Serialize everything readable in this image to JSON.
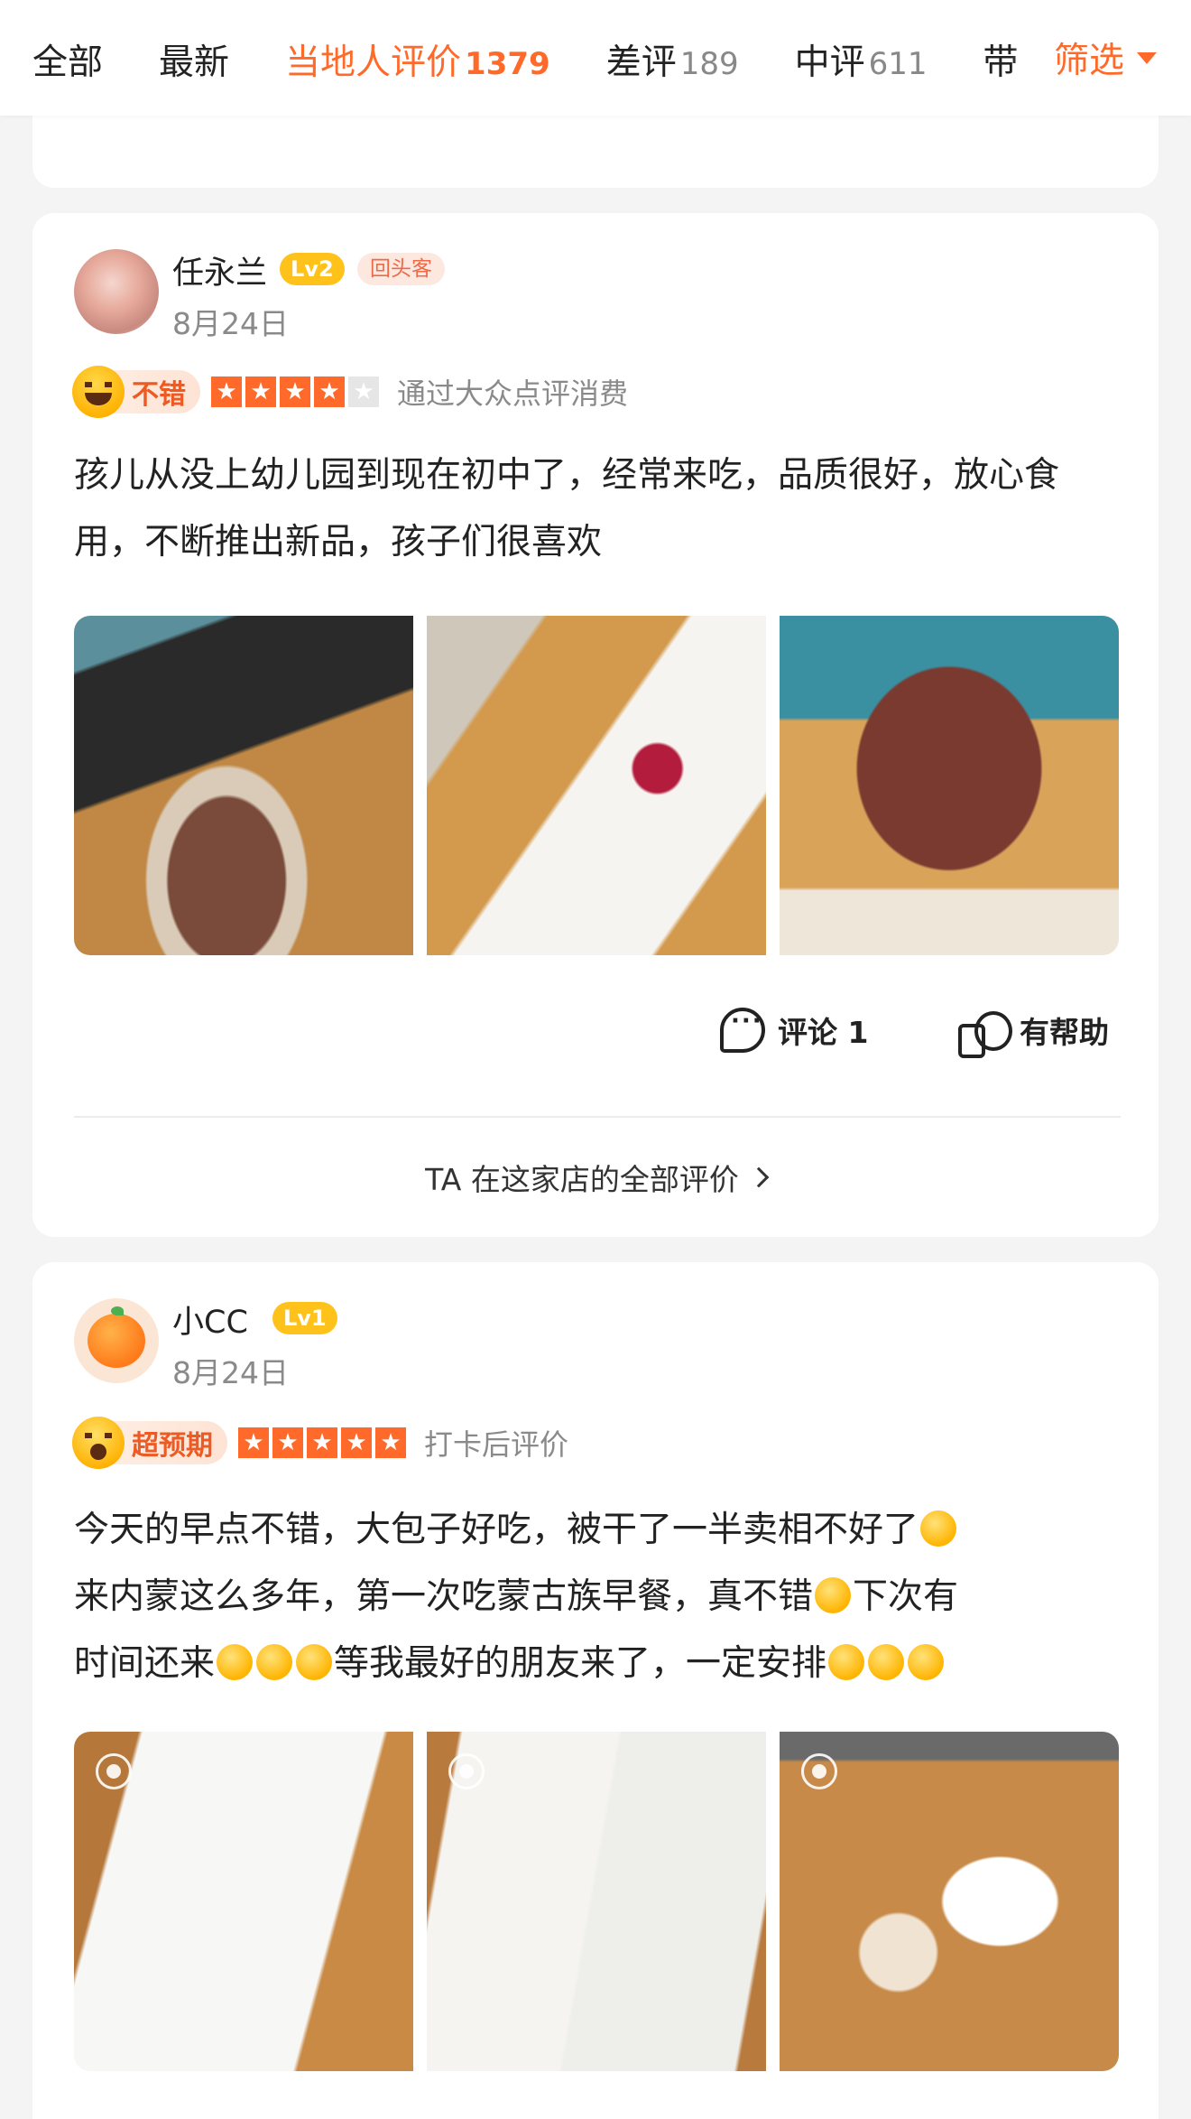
{
  "tabs": [
    {
      "label": "全部",
      "count": ""
    },
    {
      "label": "最新",
      "count": ""
    },
    {
      "label": "当地人评价",
      "count": "1379"
    },
    {
      "label": "差评",
      "count": "189"
    },
    {
      "label": "中评",
      "count": "611"
    },
    {
      "label": "带",
      "count": ""
    }
  ],
  "filter_label": "筛选",
  "reviews": [
    {
      "username": "任永兰",
      "level": "Lv2",
      "badge": "回头客",
      "date": "8月24日",
      "mood": "不错",
      "stars": 4,
      "source": "通过大众点评消费",
      "text": "孩儿从没上幼儿园到现在初中了，经常来吃，品质很好，放心食用，不断推出新品，孩子们很喜欢",
      "comment_label": "评论 1",
      "helpful_label": "有帮助",
      "all_reviews_label": "TA 在这家店的全部评价"
    },
    {
      "username": "小CC",
      "level": "Lv1",
      "date": "8月24日",
      "mood": "超预期",
      "stars": 5,
      "source": "打卡后评价",
      "text_lines": [
        "今天的早点不错，大包子好吃，被干了一半卖相不好了",
        "来内蒙这么多年，第一次吃蒙古族早餐，真不错",
        "下次有",
        "时间还来",
        "等我最好的朋友来了，一定安排"
      ]
    }
  ],
  "colors": {
    "accent": "#ff6a2a",
    "level_badge": "#ffc21a",
    "badge_bg": "#fde8e0"
  }
}
